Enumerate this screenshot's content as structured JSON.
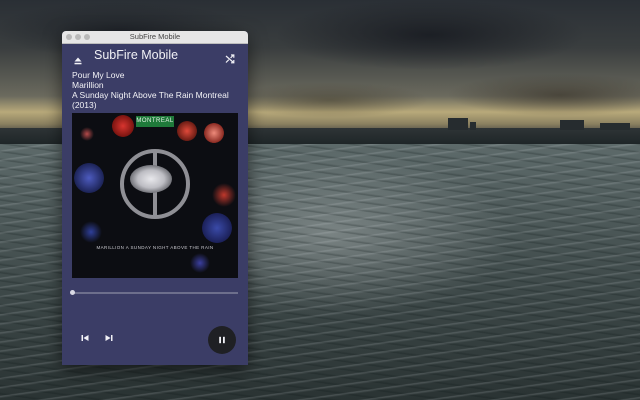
{
  "window": {
    "title": "SubFire Mobile"
  },
  "app": {
    "title": "SubFire Mobile"
  },
  "now_playing": {
    "track": "Pour My Love",
    "artist": "Marillion",
    "album": "A Sunday Night Above The Rain Montreal (2013)"
  },
  "album_art": {
    "tag": "MONTREAL",
    "caption": "MARILLION   A SUNDAY NIGHT ABOVE THE RAIN"
  },
  "icons": {
    "eject": "eject-icon",
    "shuffle": "shuffle-icon",
    "previous": "skip-previous-icon",
    "next": "skip-next-icon",
    "pause": "pause-icon"
  },
  "playback": {
    "progress": 0.0
  },
  "colors": {
    "panel": "#3b3d66",
    "accent_green": "#1f7a3a"
  }
}
